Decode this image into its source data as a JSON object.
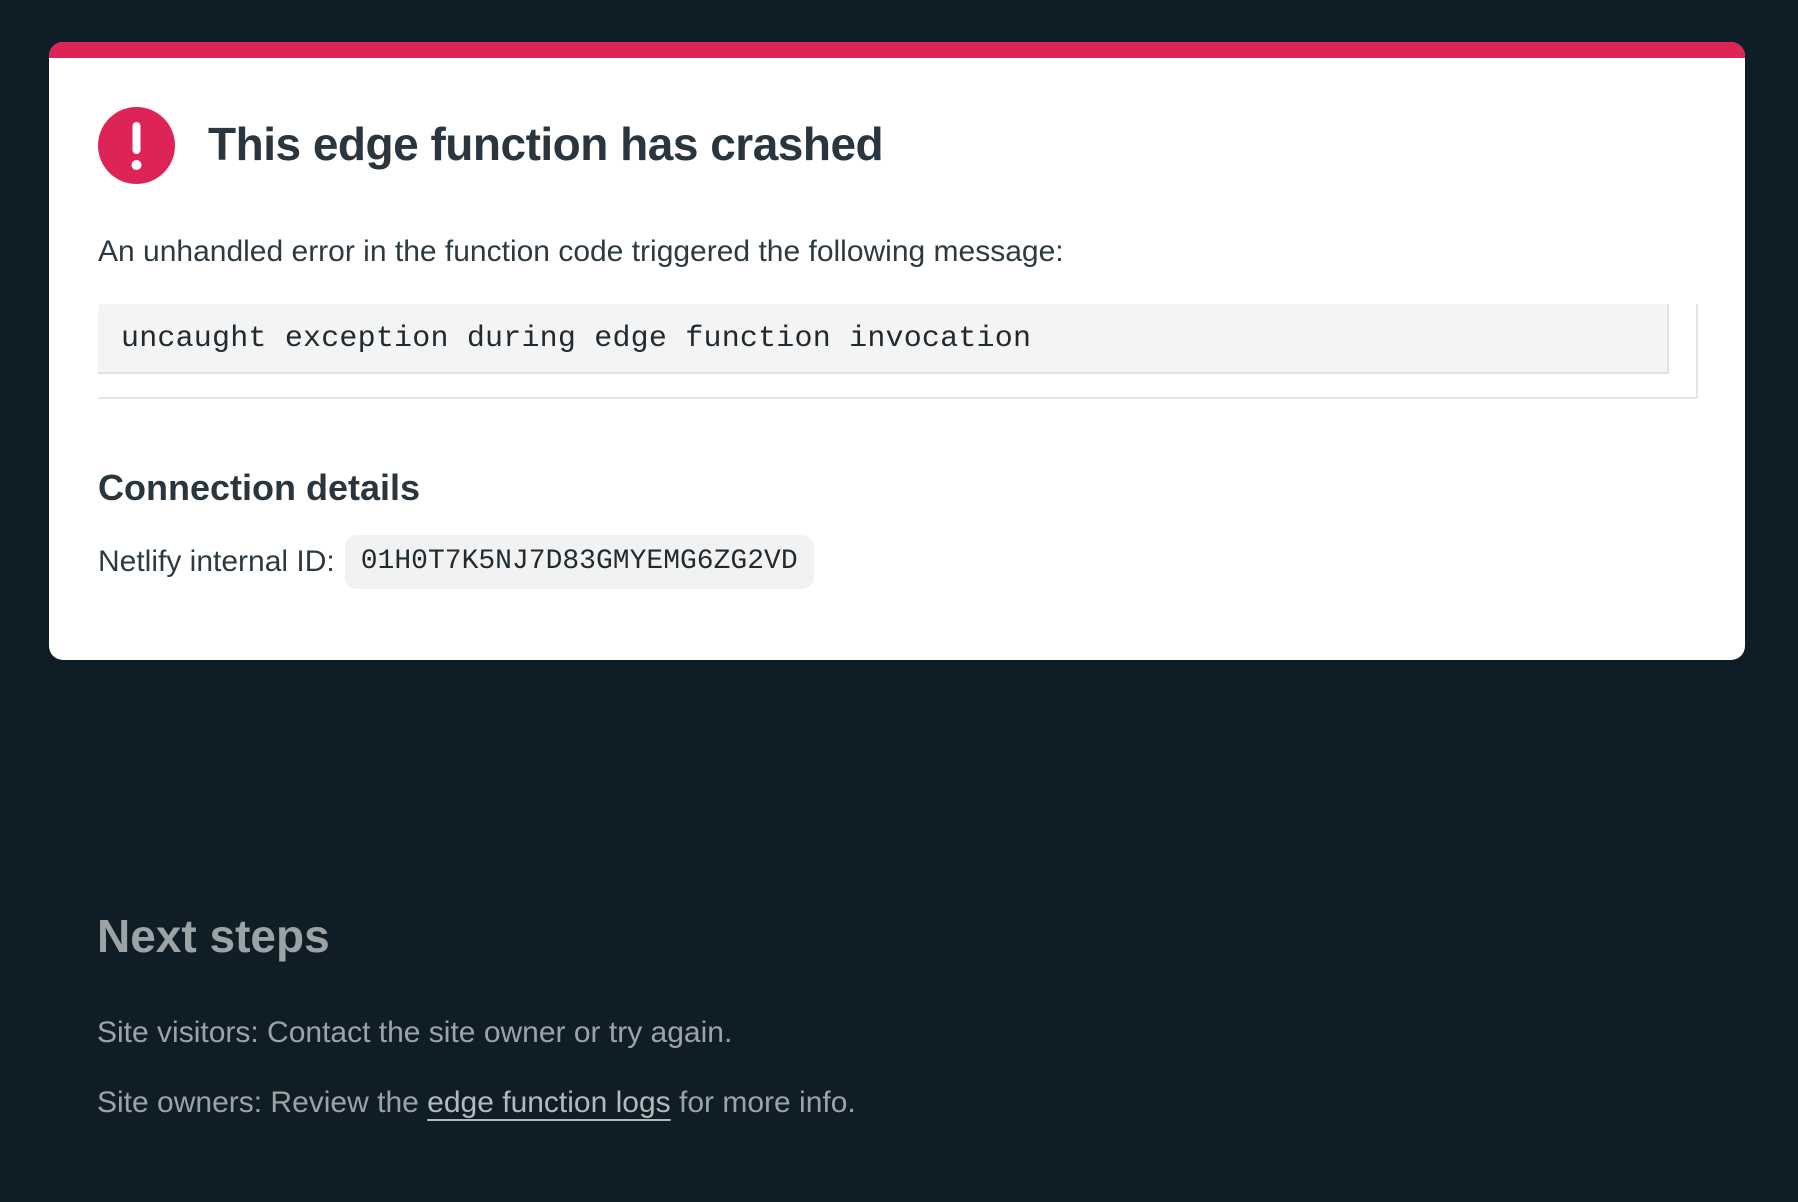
{
  "colors": {
    "background": "#0f1e26",
    "card": "#ffffff",
    "accent": "#de2457",
    "muted_text": "#9ca3a7"
  },
  "error_card": {
    "icon": "exclamation-circle-icon",
    "title": "This edge function has crashed",
    "intro": "An unhandled error in the function code triggered the following message:",
    "error_message": "uncaught exception during edge function invocation",
    "connection_heading": "Connection details",
    "internal_id_label": "Netlify internal ID:",
    "internal_id_value": "01H0T7K5NJ7D83GMYEMG6ZG2VD"
  },
  "next_steps": {
    "heading": "Next steps",
    "visitors_text": "Site visitors: Contact the site owner or try again.",
    "owners_prefix": "Site owners: Review the ",
    "owners_link": "edge function logs",
    "owners_suffix": " for more info."
  }
}
